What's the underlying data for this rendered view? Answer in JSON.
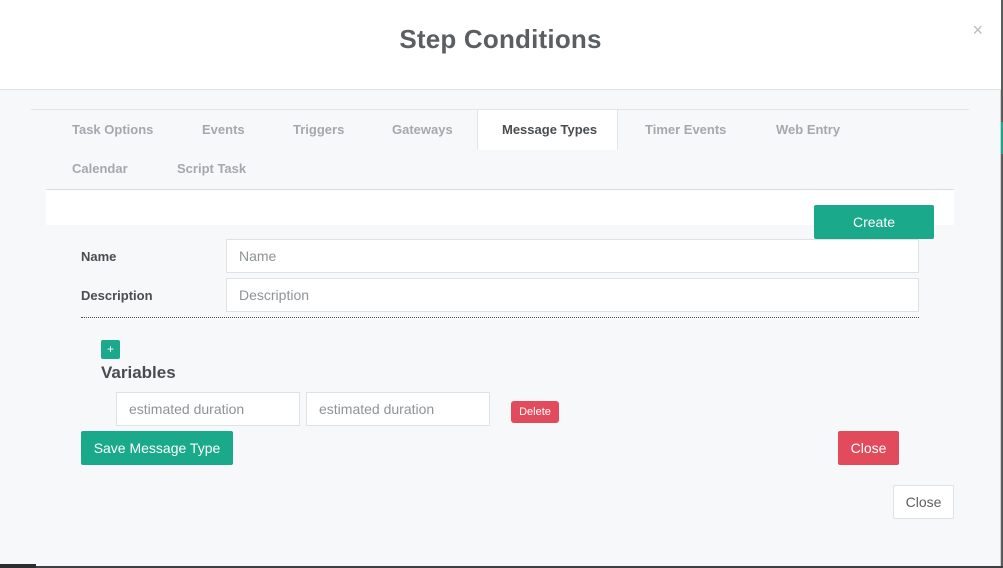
{
  "modal": {
    "title": "Step Conditions",
    "close_symbol": "×"
  },
  "tabs": [
    {
      "label": "Task Options"
    },
    {
      "label": "Events"
    },
    {
      "label": "Triggers"
    },
    {
      "label": "Gateways"
    },
    {
      "label": "Message Types",
      "active": true
    },
    {
      "label": "Timer Events"
    },
    {
      "label": "Web Entry"
    },
    {
      "label": "Calendar"
    },
    {
      "label": "Script Task"
    }
  ],
  "toolbar": {
    "create_label": "Create"
  },
  "form": {
    "name_label": "Name",
    "name_placeholder": "Name",
    "name_value": "",
    "description_label": "Description",
    "description_placeholder": "Description",
    "description_value": ""
  },
  "variables": {
    "add_symbol": "+",
    "title": "Variables",
    "rows": [
      {
        "field1_placeholder": "estimated duration",
        "field2_placeholder": "estimated duration",
        "delete_label": "Delete"
      }
    ]
  },
  "actions": {
    "save_label": "Save Message Type",
    "close_label": "Close"
  },
  "footer": {
    "close_label": "Close"
  },
  "colors": {
    "accent_green": "#1aa98a",
    "danger_red": "#e24b5b"
  },
  "icons": {
    "close": "close-icon",
    "add": "plus-icon"
  }
}
